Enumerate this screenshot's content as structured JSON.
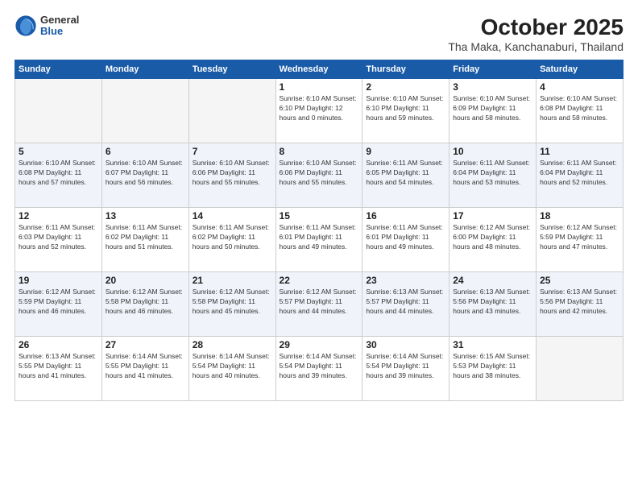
{
  "header": {
    "logo_general": "General",
    "logo_blue": "Blue",
    "month_title": "October 2025",
    "location": "Tha Maka, Kanchanaburi, Thailand"
  },
  "weekdays": [
    "Sunday",
    "Monday",
    "Tuesday",
    "Wednesday",
    "Thursday",
    "Friday",
    "Saturday"
  ],
  "weeks": [
    [
      {
        "day": "",
        "info": ""
      },
      {
        "day": "",
        "info": ""
      },
      {
        "day": "",
        "info": ""
      },
      {
        "day": "1",
        "info": "Sunrise: 6:10 AM\nSunset: 6:10 PM\nDaylight: 12 hours\nand 0 minutes."
      },
      {
        "day": "2",
        "info": "Sunrise: 6:10 AM\nSunset: 6:10 PM\nDaylight: 11 hours\nand 59 minutes."
      },
      {
        "day": "3",
        "info": "Sunrise: 6:10 AM\nSunset: 6:09 PM\nDaylight: 11 hours\nand 58 minutes."
      },
      {
        "day": "4",
        "info": "Sunrise: 6:10 AM\nSunset: 6:08 PM\nDaylight: 11 hours\nand 58 minutes."
      }
    ],
    [
      {
        "day": "5",
        "info": "Sunrise: 6:10 AM\nSunset: 6:08 PM\nDaylight: 11 hours\nand 57 minutes."
      },
      {
        "day": "6",
        "info": "Sunrise: 6:10 AM\nSunset: 6:07 PM\nDaylight: 11 hours\nand 56 minutes."
      },
      {
        "day": "7",
        "info": "Sunrise: 6:10 AM\nSunset: 6:06 PM\nDaylight: 11 hours\nand 55 minutes."
      },
      {
        "day": "8",
        "info": "Sunrise: 6:10 AM\nSunset: 6:06 PM\nDaylight: 11 hours\nand 55 minutes."
      },
      {
        "day": "9",
        "info": "Sunrise: 6:11 AM\nSunset: 6:05 PM\nDaylight: 11 hours\nand 54 minutes."
      },
      {
        "day": "10",
        "info": "Sunrise: 6:11 AM\nSunset: 6:04 PM\nDaylight: 11 hours\nand 53 minutes."
      },
      {
        "day": "11",
        "info": "Sunrise: 6:11 AM\nSunset: 6:04 PM\nDaylight: 11 hours\nand 52 minutes."
      }
    ],
    [
      {
        "day": "12",
        "info": "Sunrise: 6:11 AM\nSunset: 6:03 PM\nDaylight: 11 hours\nand 52 minutes."
      },
      {
        "day": "13",
        "info": "Sunrise: 6:11 AM\nSunset: 6:02 PM\nDaylight: 11 hours\nand 51 minutes."
      },
      {
        "day": "14",
        "info": "Sunrise: 6:11 AM\nSunset: 6:02 PM\nDaylight: 11 hours\nand 50 minutes."
      },
      {
        "day": "15",
        "info": "Sunrise: 6:11 AM\nSunset: 6:01 PM\nDaylight: 11 hours\nand 49 minutes."
      },
      {
        "day": "16",
        "info": "Sunrise: 6:11 AM\nSunset: 6:01 PM\nDaylight: 11 hours\nand 49 minutes."
      },
      {
        "day": "17",
        "info": "Sunrise: 6:12 AM\nSunset: 6:00 PM\nDaylight: 11 hours\nand 48 minutes."
      },
      {
        "day": "18",
        "info": "Sunrise: 6:12 AM\nSunset: 5:59 PM\nDaylight: 11 hours\nand 47 minutes."
      }
    ],
    [
      {
        "day": "19",
        "info": "Sunrise: 6:12 AM\nSunset: 5:59 PM\nDaylight: 11 hours\nand 46 minutes."
      },
      {
        "day": "20",
        "info": "Sunrise: 6:12 AM\nSunset: 5:58 PM\nDaylight: 11 hours\nand 46 minutes."
      },
      {
        "day": "21",
        "info": "Sunrise: 6:12 AM\nSunset: 5:58 PM\nDaylight: 11 hours\nand 45 minutes."
      },
      {
        "day": "22",
        "info": "Sunrise: 6:12 AM\nSunset: 5:57 PM\nDaylight: 11 hours\nand 44 minutes."
      },
      {
        "day": "23",
        "info": "Sunrise: 6:13 AM\nSunset: 5:57 PM\nDaylight: 11 hours\nand 44 minutes."
      },
      {
        "day": "24",
        "info": "Sunrise: 6:13 AM\nSunset: 5:56 PM\nDaylight: 11 hours\nand 43 minutes."
      },
      {
        "day": "25",
        "info": "Sunrise: 6:13 AM\nSunset: 5:56 PM\nDaylight: 11 hours\nand 42 minutes."
      }
    ],
    [
      {
        "day": "26",
        "info": "Sunrise: 6:13 AM\nSunset: 5:55 PM\nDaylight: 11 hours\nand 41 minutes."
      },
      {
        "day": "27",
        "info": "Sunrise: 6:14 AM\nSunset: 5:55 PM\nDaylight: 11 hours\nand 41 minutes."
      },
      {
        "day": "28",
        "info": "Sunrise: 6:14 AM\nSunset: 5:54 PM\nDaylight: 11 hours\nand 40 minutes."
      },
      {
        "day": "29",
        "info": "Sunrise: 6:14 AM\nSunset: 5:54 PM\nDaylight: 11 hours\nand 39 minutes."
      },
      {
        "day": "30",
        "info": "Sunrise: 6:14 AM\nSunset: 5:54 PM\nDaylight: 11 hours\nand 39 minutes."
      },
      {
        "day": "31",
        "info": "Sunrise: 6:15 AM\nSunset: 5:53 PM\nDaylight: 11 hours\nand 38 minutes."
      },
      {
        "day": "",
        "info": ""
      }
    ]
  ]
}
